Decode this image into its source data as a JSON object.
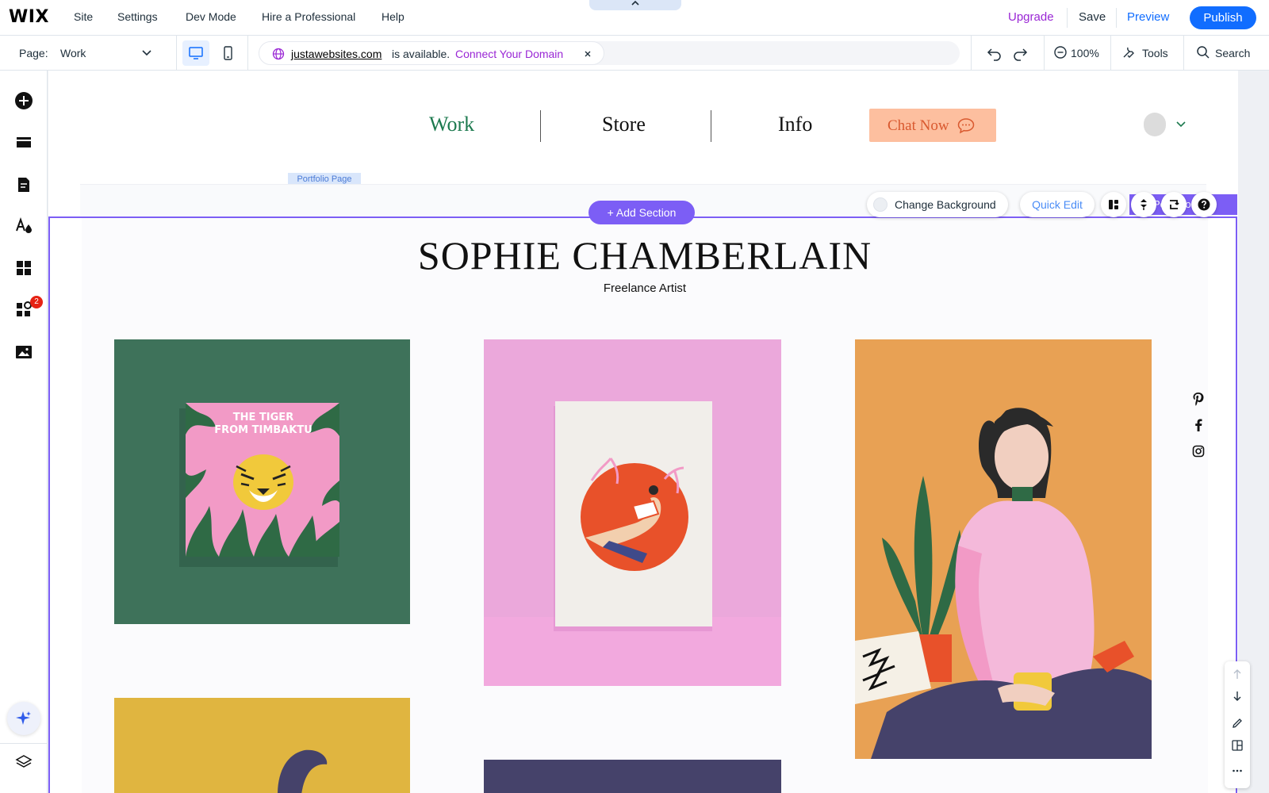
{
  "topbar": {
    "logo": "WIX",
    "menu": [
      "Site",
      "Settings",
      "Dev Mode",
      "Hire a Professional",
      "Help"
    ],
    "upgrade": "Upgrade",
    "save": "Save",
    "preview": "Preview",
    "publish": "Publish"
  },
  "toolbar": {
    "page_label": "Page:",
    "page_value": "Work",
    "domain": "justawebsites.com",
    "domain_available": "is available.",
    "domain_connect": "Connect Your Domain",
    "zoom": "100%",
    "tools": "Tools",
    "search": "Search"
  },
  "leftbar": {
    "badge_count": "2"
  },
  "site": {
    "nav": [
      "Work",
      "Store",
      "Info"
    ],
    "chat_button": "Chat Now",
    "section_tag": "Portfolio Page",
    "name": "SOPHIE CHAMBERLAIN",
    "subtitle": "Freelance Artist",
    "book_title_line1": "THE TIGER",
    "book_title_line2": "FROM TIMBAKTU"
  },
  "editor": {
    "add_section": "+ Add Section",
    "change_background": "Change Background",
    "quick_edit": "Quick Edit",
    "section_label": "Portfolio"
  },
  "colors": {
    "accent": "#116dff",
    "section_outline": "#7c5ef5",
    "upgrade": "#9a27d5",
    "nav_active": "#1d7a4f"
  }
}
